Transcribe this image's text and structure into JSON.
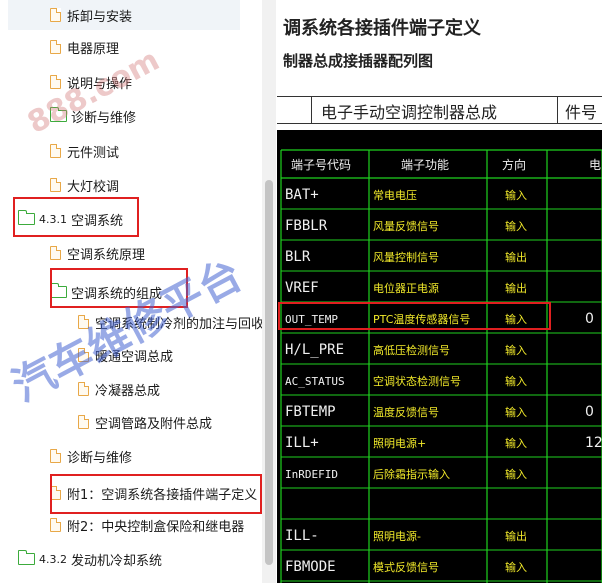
{
  "tree": {
    "items": [
      {
        "label": "拆卸与安装",
        "icon": "document-icon"
      },
      {
        "label": "电器原理",
        "icon": "document-icon"
      },
      {
        "label": "说明与操作",
        "icon": "document-icon"
      },
      {
        "label": "诊断与维修",
        "icon": "folder-icon"
      },
      {
        "label": "元件测试",
        "icon": "document-icon"
      },
      {
        "label": "大灯校调",
        "icon": "document-icon"
      },
      {
        "num": "4.3.1",
        "label": "空调系统",
        "icon": "folder-icon"
      },
      {
        "label": "空调系统原理",
        "icon": "document-icon"
      },
      {
        "label": "空调系统的组成",
        "icon": "folder-open-icon"
      },
      {
        "label": "空调系统制冷剂的加注与回收",
        "icon": "document-icon"
      },
      {
        "label": "暖通空调总成",
        "icon": "document-icon"
      },
      {
        "label": "冷凝器总成",
        "icon": "document-icon"
      },
      {
        "label": "空调管路及附件总成",
        "icon": "document-icon"
      },
      {
        "label": "诊断与维修",
        "icon": "document-icon"
      },
      {
        "label": "附1：空调系统各接插件端子定义",
        "icon": "document-icon"
      },
      {
        "label": "附2：中央控制盒保险和继电器",
        "icon": "document-icon"
      },
      {
        "num": "4.3.2",
        "label": "发动机冷却系统",
        "icon": "folder-icon"
      }
    ]
  },
  "doc": {
    "title": "调系统各接插件端子定义",
    "subtitle": "制器总成接插器配列图",
    "assembly_label": "电子手动空调控制器总成",
    "part_no_label": "件号",
    "watermark_1": "888.com",
    "watermark_2": "汽车维修平台",
    "table": {
      "headers": [
        "端子号代码",
        "端子功能",
        "方向",
        "电"
      ],
      "rows": [
        [
          "BAT+",
          "常电电压",
          "输入",
          ""
        ],
        [
          "FBBLR",
          "风量反馈信号",
          "输入",
          ""
        ],
        [
          "BLR",
          "风量控制信号",
          "输出",
          ""
        ],
        [
          "VREF",
          "电位器正电源",
          "输出",
          ""
        ],
        [
          "OUT_TEMP",
          "PTC温度传感器信号",
          "输入",
          "0"
        ],
        [
          "H/L_PRE",
          "高低压检测信号",
          "输入",
          ""
        ],
        [
          "AC_STATUS",
          "空调状态检测信号",
          "输入",
          ""
        ],
        [
          "FBTEMP",
          "温度反馈信号",
          "输入",
          "0"
        ],
        [
          "ILL+",
          "照明电源+",
          "输入",
          "12"
        ],
        [
          "InRDEFID",
          "后除霜指示输入",
          "输入",
          ""
        ],
        [
          "",
          "",
          "",
          ""
        ],
        [
          "ILL-",
          "照明电源-",
          "输出",
          ""
        ],
        [
          "FBMODE",
          "模式反馈信号",
          "输入",
          ""
        ]
      ]
    }
  },
  "colors": {
    "highlight": "#e02020",
    "drawing_bg": "#000000",
    "drawing_line": "#1fd11f",
    "drawing_text": "#f0f0f0",
    "drawing_yellow": "#f2ea2a",
    "folder_green": "#3cab3c",
    "document_orange": "#e8a848"
  }
}
